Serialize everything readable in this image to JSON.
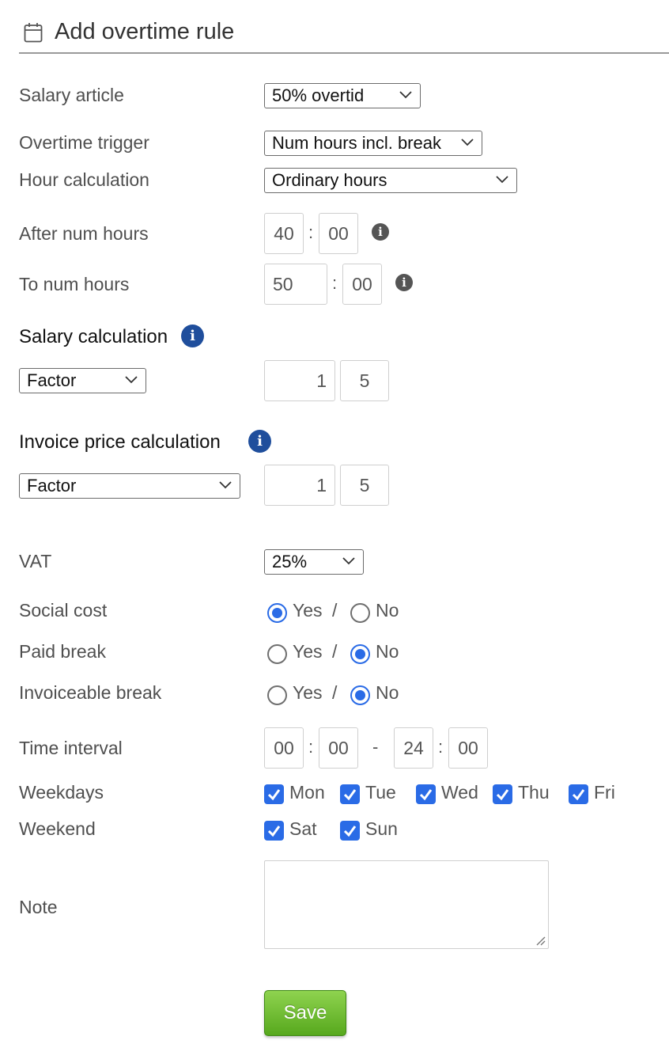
{
  "header": {
    "title": "Add overtime rule",
    "icon": "calendar-icon"
  },
  "fields": {
    "salary_article": {
      "label": "Salary article",
      "value": "50% overtid"
    },
    "overtime_trigger": {
      "label": "Overtime trigger",
      "value": "Num hours incl. break"
    },
    "hour_calculation": {
      "label": "Hour calculation",
      "value": "Ordinary hours"
    },
    "after_num_hours": {
      "label": "After num hours",
      "hours": "40",
      "minutes": "00"
    },
    "to_num_hours": {
      "label": "To num hours",
      "hours": "50",
      "minutes": "00"
    },
    "salary_calculation": {
      "label": "Salary calculation",
      "method": "Factor",
      "whole": "1",
      "fraction": "5"
    },
    "invoice_price_calculation": {
      "label": "Invoice price calculation",
      "method": "Factor",
      "whole": "1",
      "fraction": "5"
    },
    "vat": {
      "label": "VAT",
      "value": "25%"
    },
    "social_cost": {
      "label": "Social cost",
      "selected": "Yes"
    },
    "paid_break": {
      "label": "Paid break",
      "selected": "No"
    },
    "invoiceable_break": {
      "label": "Invoiceable break",
      "selected": "No"
    },
    "time_interval": {
      "label": "Time interval",
      "from_hours": "00",
      "from_minutes": "00",
      "separator": "-",
      "to_hours": "24",
      "to_minutes": "00"
    },
    "weekdays": {
      "label": "Weekdays",
      "days": [
        {
          "label": "Mon",
          "checked": true
        },
        {
          "label": "Tue",
          "checked": true
        },
        {
          "label": "Wed",
          "checked": true
        },
        {
          "label": "Thu",
          "checked": true
        },
        {
          "label": "Fri",
          "checked": true
        }
      ]
    },
    "weekend": {
      "label": "Weekend",
      "days": [
        {
          "label": "Sat",
          "checked": true
        },
        {
          "label": "Sun",
          "checked": true
        }
      ]
    },
    "note": {
      "label": "Note",
      "value": ""
    }
  },
  "common": {
    "yes": "Yes",
    "no": "No",
    "slash": "/",
    "colon": ":",
    "info_glyph": "i"
  },
  "actions": {
    "save_label": "Save"
  },
  "colors": {
    "accent": "#2a6be6",
    "info_blue": "#1f4e9c",
    "save_green": "#6cbf2c"
  }
}
